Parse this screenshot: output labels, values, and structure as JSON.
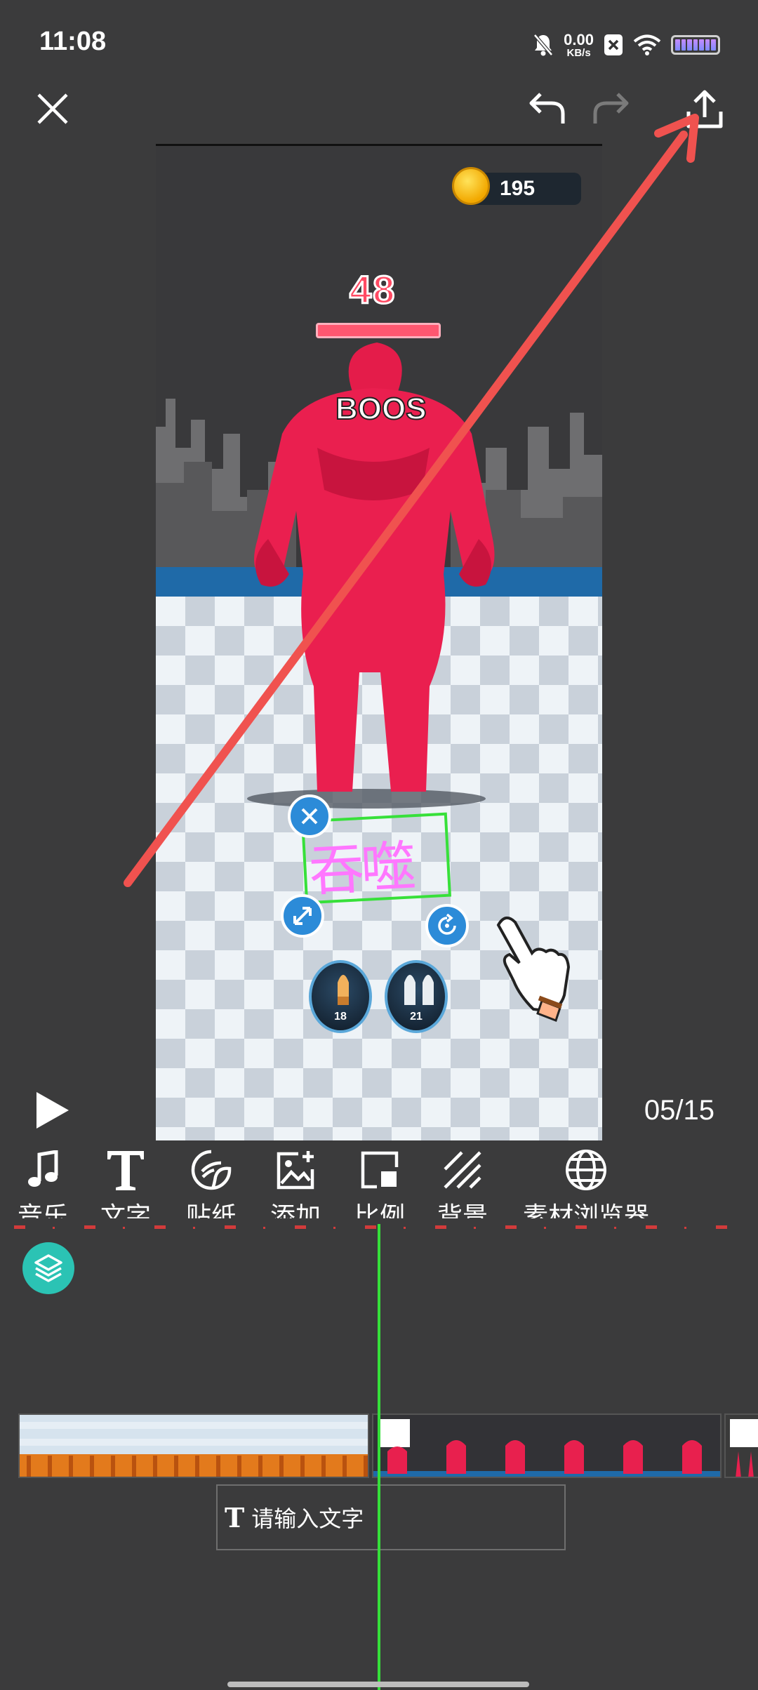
{
  "status_bar": {
    "time": "11:08",
    "net_speed_value": "0.00",
    "net_speed_unit": "KB/s",
    "icons": [
      "bell-off-icon",
      "app-notification-icon",
      "wifi-icon",
      "battery-icon"
    ]
  },
  "toolbar": {
    "close_icon": "close-icon",
    "undo_icon": "undo-icon",
    "redo_icon": "redo-icon",
    "export_icon": "upload-icon"
  },
  "preview": {
    "coins": "195",
    "enemy_hp": "48",
    "boss_label": "BOOS",
    "sticker_text": "吞噬",
    "ammo_left": "18",
    "ammo_right": "21"
  },
  "playback": {
    "time_counter": "05/15"
  },
  "tools": [
    {
      "label": "音乐",
      "icon": "music-note-icon"
    },
    {
      "label": "文字",
      "icon": "text-icon"
    },
    {
      "label": "贴纸",
      "icon": "sticker-icon"
    },
    {
      "label": "添加",
      "icon": "add-image-icon"
    },
    {
      "label": "比例",
      "icon": "aspect-ratio-icon"
    },
    {
      "label": "背景",
      "icon": "background-icon"
    },
    {
      "label": "素材浏览器",
      "icon": "globe-icon"
    }
  ],
  "text_track": {
    "placeholder": "请输入文字"
  },
  "colors": {
    "background": "#3b3b3c",
    "playhead": "#35e03a",
    "accent_teal": "#2bc3b4",
    "annotation_arrow": "#f0524f"
  }
}
